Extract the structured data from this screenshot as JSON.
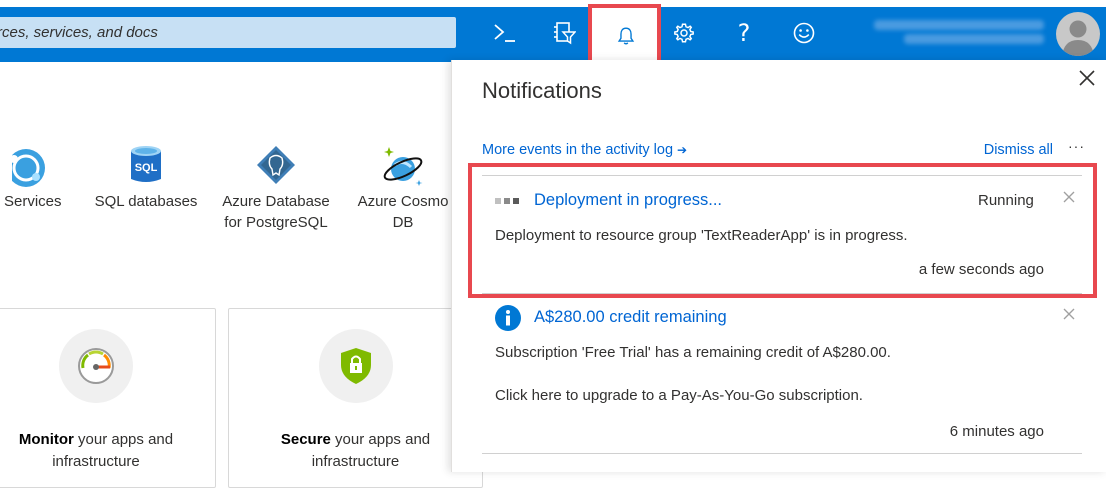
{
  "topbar": {
    "search_placeholder": "rces, services, and docs",
    "icons": [
      "cloud-shell-icon",
      "directory-filter-icon",
      "notifications-bell-icon",
      "settings-gear-icon",
      "help-question-icon",
      "feedback-smiley-icon"
    ],
    "help_glyph": "?"
  },
  "services": [
    {
      "label": "Services",
      "icon": "app-services-icon"
    },
    {
      "label": "SQL databases",
      "icon": "sql-database-icon"
    },
    {
      "label": "Azure Database for PostgreSQL",
      "icon": "postgresql-icon"
    },
    {
      "label": "Azure Cosmos DB",
      "icon": "cosmos-db-icon"
    }
  ],
  "svc_labels": {
    "s0": "Services",
    "s1": "SQL databases",
    "s2a": "Azure Database",
    "s2b": "for PostgreSQL",
    "s3a": "Azure Cosmo",
    "s3b": "DB"
  },
  "cards": {
    "monitor": {
      "bold": "Monitor",
      "rest": " your apps and",
      "line2": "infrastructure"
    },
    "secure": {
      "bold": "Secure",
      "rest": " your apps and",
      "line2": "infrastructure"
    }
  },
  "notifications": {
    "title": "Notifications",
    "more_events": "More events in the activity log",
    "more_arrow": "➔",
    "dismiss_all": "Dismiss all",
    "more_dots": "···",
    "items": [
      {
        "title": "Deployment in progress...",
        "status": "Running",
        "body": "Deployment to resource group 'TextReaderApp' is in progress.",
        "time": "a few seconds ago"
      },
      {
        "title": "A$280.00 credit remaining",
        "body": "Subscription 'Free Trial' has a remaining credit of A$280.00.",
        "link": "Click here to upgrade to a Pay-As-You-Go subscription.",
        "time": "6 minutes ago"
      }
    ]
  },
  "colors": {
    "accent": "#0078d4",
    "link": "#0065d3",
    "highlight": "#e8484f"
  }
}
